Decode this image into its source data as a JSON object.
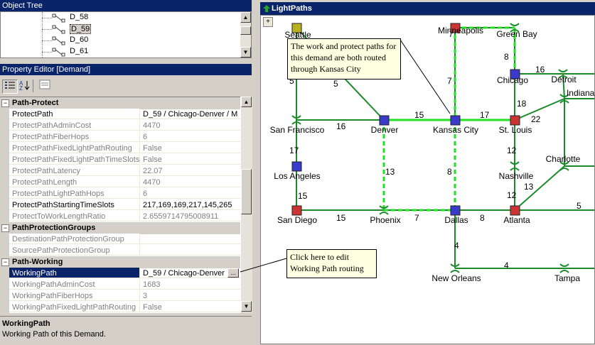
{
  "object_tree": {
    "title": "Object Tree",
    "items": [
      "D_58",
      "D_59",
      "D_60",
      "D_61"
    ]
  },
  "property_editor": {
    "title": "Property Editor [Demand]",
    "categories": [
      {
        "name": "Path-Protect",
        "rows": [
          {
            "name": "ProtectPath",
            "value": "D_59 / Chicago-Denver / M",
            "readonly": false
          },
          {
            "name": "ProtectPathAdminCost",
            "value": "4470",
            "readonly": true
          },
          {
            "name": "ProtectPathFiberHops",
            "value": "6",
            "readonly": true
          },
          {
            "name": "ProtectPathFixedLightPathRouting",
            "value": "False",
            "readonly": true
          },
          {
            "name": "ProtectPathFixedLightPathTimeSlots",
            "value": "False",
            "readonly": true
          },
          {
            "name": "ProtectPathLatency",
            "value": "22.07",
            "readonly": true
          },
          {
            "name": "ProtectPathLength",
            "value": "4470",
            "readonly": true
          },
          {
            "name": "ProtectPathLightPathHops",
            "value": "6",
            "readonly": true
          },
          {
            "name": "ProtectPathStartingTimeSlots",
            "value": "217,169,169,217,145,265",
            "readonly": false
          },
          {
            "name": "ProtectToWorkLengthRatio",
            "value": "2.6559714795008911",
            "readonly": true
          }
        ]
      },
      {
        "name": "PathProtectionGroups",
        "rows": [
          {
            "name": "DestinationPathProtectionGroup",
            "value": "",
            "readonly": true
          },
          {
            "name": "SourcePathProtectionGroup",
            "value": "",
            "readonly": true
          }
        ]
      },
      {
        "name": "Path-Working",
        "rows": [
          {
            "name": "WorkingPath",
            "value": "D_59 / Chicago-Denver",
            "readonly": false,
            "selected": true
          },
          {
            "name": "WorkingPathAdminCost",
            "value": "1683",
            "readonly": true
          },
          {
            "name": "WorkingPathFiberHops",
            "value": "3",
            "readonly": true
          },
          {
            "name": "WorkingPathFixedLightPathRouting",
            "value": "False",
            "readonly": true
          }
        ]
      }
    ],
    "ellipsis_label": "...",
    "description_title": "WorkingPath",
    "description_text": "Working Path of this Demand."
  },
  "map": {
    "title": "LightPaths",
    "expand_label": "+",
    "callout_top": "The work and protect paths for this demand are both routed through Kansas City",
    "callout_bottom": "Click here to edit Working Path routing",
    "colors": {
      "link": "#1a8a2a",
      "path": "#22e022",
      "node_blue": "#3a3acc",
      "node_red": "#cc3333",
      "node_yellow": "#b8b020"
    },
    "nodes": [
      {
        "name": "Seattle",
        "kind": "node_yellow"
      },
      {
        "name": "Minneapolis",
        "kind": "node_red"
      },
      {
        "name": "Green Bay",
        "kind": "switch"
      },
      {
        "name": "Chicago",
        "kind": "node_blue"
      },
      {
        "name": "Detroit",
        "kind": "switch"
      },
      {
        "name": "Indianapolis",
        "kind": "switch"
      },
      {
        "name": "San Francisco",
        "kind": "switch"
      },
      {
        "name": "Denver",
        "kind": "node_blue"
      },
      {
        "name": "Kansas City",
        "kind": "node_blue"
      },
      {
        "name": "St. Louis",
        "kind": "node_red"
      },
      {
        "name": "Los Angeles",
        "kind": "node_blue"
      },
      {
        "name": "Nashville",
        "kind": "switch"
      },
      {
        "name": "Charlotte",
        "kind": "switch"
      },
      {
        "name": "San Diego",
        "kind": "node_red"
      },
      {
        "name": "Phoenix",
        "kind": "switch"
      },
      {
        "name": "Dallas",
        "kind": "node_blue"
      },
      {
        "name": "Atlanta",
        "kind": "node_red"
      },
      {
        "name": "New Orleans",
        "kind": "switch"
      },
      {
        "name": "Tampa",
        "kind": "switch"
      }
    ],
    "link_labels": [
      "7",
      "8",
      "16",
      "5",
      "5",
      "7",
      "18",
      "22",
      "16",
      "15",
      "17",
      "17",
      "13",
      "8",
      "12",
      "15",
      "15",
      "7",
      "8",
      "12",
      "13",
      "5",
      "4",
      "4"
    ]
  }
}
